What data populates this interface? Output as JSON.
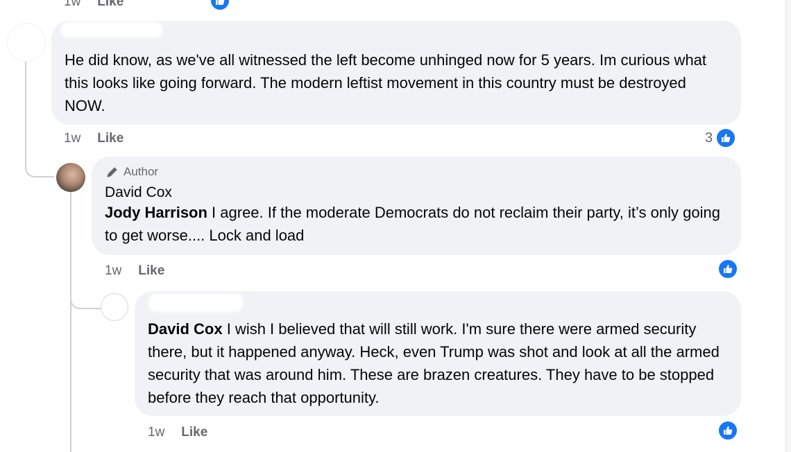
{
  "top_partial": {
    "time": "1w",
    "like": "Like"
  },
  "comment1": {
    "text": "He did know, as we've all witnessed the left become unhinged now for 5 years. Im curious what this looks like going forward. The modern leftist movement in this country must be destroyed NOW.",
    "time": "1w",
    "like": "Like",
    "reaction_count": "3",
    "reaction_icon": "like-icon"
  },
  "comment2": {
    "author_badge": "Author",
    "author_icon": "pencil-icon",
    "name": "David Cox",
    "mention": "Jody Harrison",
    "text": " I agree. If the moderate Democrats do not reclaim their party, it’s only going to get worse.... Lock and load",
    "time": "1w",
    "like": "Like",
    "reaction_icon": "like-icon"
  },
  "comment3": {
    "mention": "David Cox",
    "text": " I wish I believed that will still work. I'm sure there were armed security there, but it happened anyway. Heck, even Trump was shot and look at all the armed security that was around him. These are brazen creatures. They have to be stopped before they reach that opportunity.",
    "time": "1w",
    "like": "Like",
    "reaction_icon": "like-icon"
  },
  "colors": {
    "bubble": "#f0f2f5",
    "like_blue": "#1877f2",
    "meta_gray": "#65676b",
    "thread_line": "#ced0d4"
  }
}
